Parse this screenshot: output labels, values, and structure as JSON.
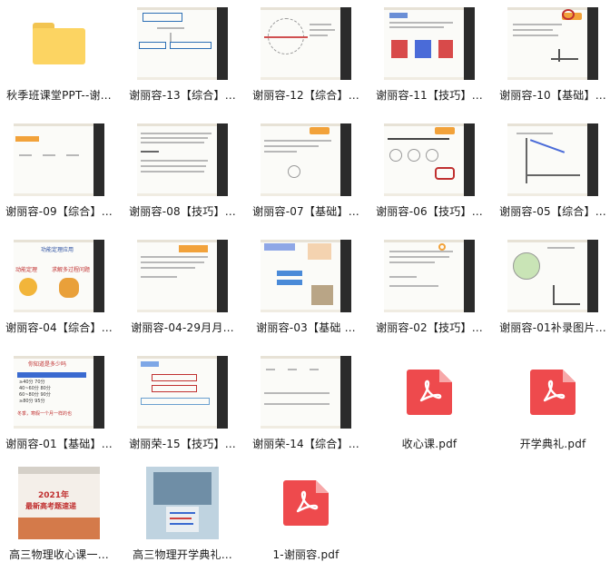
{
  "files": [
    {
      "name": "秋季班课堂PPT--谢…",
      "kind": "folder"
    },
    {
      "name": "谢丽容-13【综合】…",
      "kind": "slide"
    },
    {
      "name": "谢丽容-12【综合】…",
      "kind": "slide"
    },
    {
      "name": "谢丽容-11【技巧】…",
      "kind": "slide"
    },
    {
      "name": "谢丽容-10【基础】…",
      "kind": "slide"
    },
    {
      "name": "谢丽容-09【综合】…",
      "kind": "slide"
    },
    {
      "name": "谢丽容-08【技巧】…",
      "kind": "slide"
    },
    {
      "name": "谢丽容-07【基础】…",
      "kind": "slide"
    },
    {
      "name": "谢丽容-06【技巧】…",
      "kind": "slide"
    },
    {
      "name": "谢丽容-05【综合】…",
      "kind": "slide"
    },
    {
      "name": "谢丽容-04【综合】…",
      "kind": "slide"
    },
    {
      "name": "谢丽容-04-29月月…",
      "kind": "slide"
    },
    {
      "name": "谢丽容-03【基础 …",
      "kind": "slide"
    },
    {
      "name": "谢丽容-02【技巧】…",
      "kind": "slide"
    },
    {
      "name": "谢丽容-01补录图片…",
      "kind": "slide"
    },
    {
      "name": "谢丽容-01【基础】…",
      "kind": "slide"
    },
    {
      "name": "谢丽荣-15【技巧】…",
      "kind": "slide"
    },
    {
      "name": "谢丽荣-14【综合】…",
      "kind": "slide"
    },
    {
      "name": "收心课.pdf",
      "kind": "pdf"
    },
    {
      "name": "开学典礼.pdf",
      "kind": "pdf"
    },
    {
      "name": "高三物理收心课一…",
      "kind": "photo"
    },
    {
      "name": "高三物理开学典礼…",
      "kind": "photo"
    },
    {
      "name": "1-谢丽容.pdf",
      "kind": "pdf"
    }
  ],
  "thumb_text": {
    "t04_a": "功能定理应用",
    "t04_b": "动能定理",
    "t04_c": "求解多过程问题",
    "t01_title": "你知道是多少吗",
    "t01_rows": [
      "≥40分 70分",
      "40~60分 80分",
      "60~80分 90分",
      "≥80分 95分"
    ],
    "t01_note": "冬季，寒假一个月一样的也",
    "photo1_year": "2021年",
    "photo1_title": "最新高考题速递"
  }
}
